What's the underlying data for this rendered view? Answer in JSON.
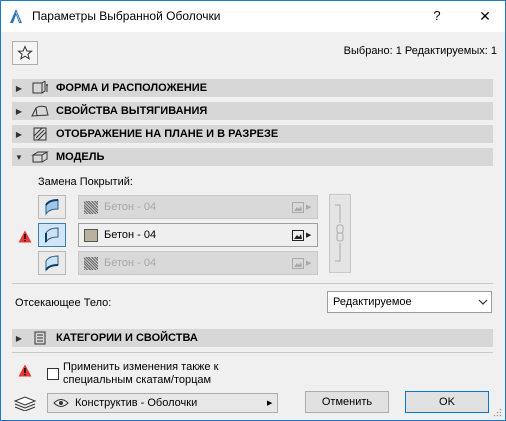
{
  "window": {
    "title": "Параметры Выбранной Оболочки",
    "help_label": "?",
    "close_label": "✕"
  },
  "header": {
    "favorites_icon": "star-icon",
    "selection_info": "Выбрано: 1 Редактируемых: 1"
  },
  "sections": [
    {
      "label": "ФОРМА И РАСПОЛОЖЕНИЕ",
      "expanded": false,
      "icon": "shape-position-icon"
    },
    {
      "label": "СВОЙСТВА ВЫТЯГИВАНИЯ",
      "expanded": false,
      "icon": "extrusion-icon"
    },
    {
      "label": "ОТОБРАЖЕНИЕ НА ПЛАНЕ И В РАЗРЕЗЕ",
      "expanded": false,
      "icon": "floorplan-section-icon"
    },
    {
      "label": "МОДЕЛЬ",
      "expanded": true,
      "icon": "model-icon"
    },
    {
      "label": "КАТЕГОРИИ И СВОЙСТВА",
      "expanded": false,
      "icon": "categories-icon"
    }
  ],
  "model": {
    "surface_override_label": "Замена Покрытий:",
    "materials": [
      {
        "name": "Бетон - 04",
        "active": false
      },
      {
        "name": "Бетон - 04",
        "active": true
      },
      {
        "name": "Бетон - 04",
        "active": false
      }
    ],
    "cut_body_label": "Отсекающее Тело:",
    "cut_body_value": "Редактируемое"
  },
  "footer": {
    "apply_label_line1": "Применить изменения также к",
    "apply_label_line2": "специальным скатам/торцам",
    "layer_value": "Конструктив - Оболочки",
    "cancel_label": "Отменить",
    "ok_label": "OK"
  },
  "colors": {
    "section_bar": "#d7d7d7",
    "warning": "#e53935",
    "accent_border": "#0078d7",
    "concrete_swatch": "#b7b29d"
  }
}
